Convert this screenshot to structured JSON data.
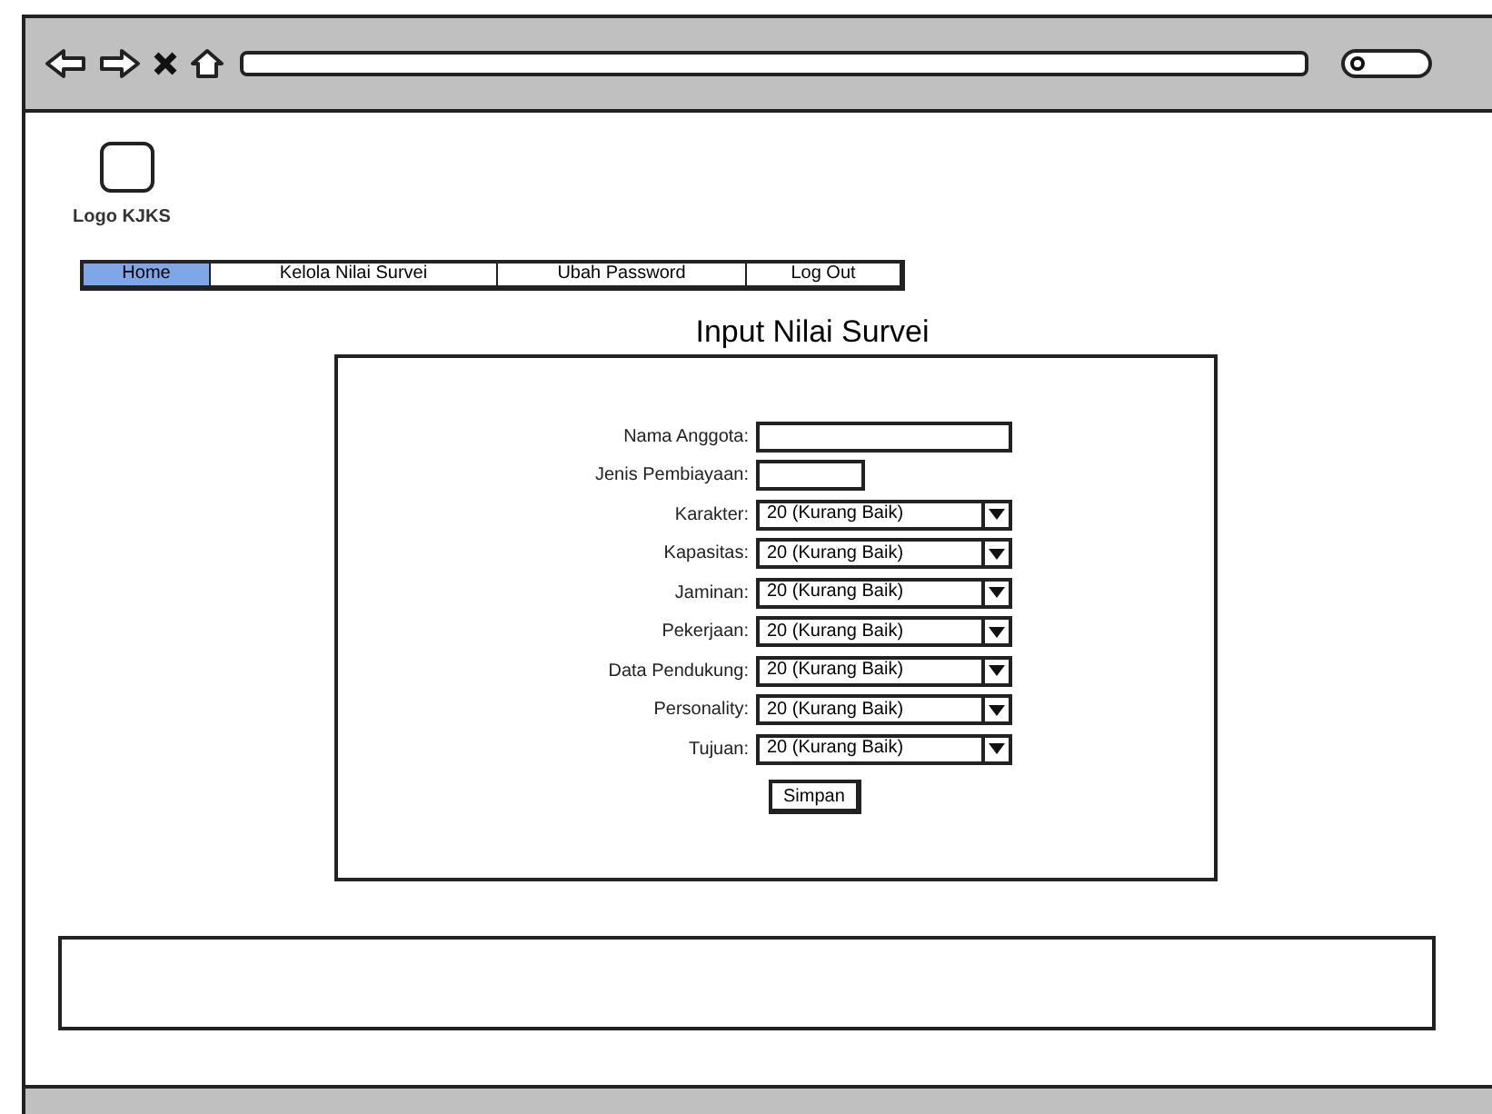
{
  "logo": {
    "label": "Logo KJKS"
  },
  "nav": [
    {
      "label": "Home",
      "selected": true
    },
    {
      "label": "Kelola Nilai Survei",
      "selected": false
    },
    {
      "label": "Ubah Password",
      "selected": false
    },
    {
      "label": "Log Out",
      "selected": false
    }
  ],
  "title": "Input Nilai Survei",
  "form": {
    "fields": [
      {
        "kind": "text",
        "label": "Nama Anggota:"
      },
      {
        "kind": "short",
        "label": "Jenis Pembiayaan:"
      },
      {
        "kind": "select",
        "label": "Karakter:",
        "value": "20 (Kurang Baik)"
      },
      {
        "kind": "select",
        "label": "Kapasitas:",
        "value": "20 (Kurang Baik)"
      },
      {
        "kind": "select",
        "label": "Jaminan:",
        "value": "20 (Kurang Baik)"
      },
      {
        "kind": "select",
        "label": "Pekerjaan:",
        "value": "20 (Kurang Baik)"
      },
      {
        "kind": "select",
        "label": "Data Pendukung:",
        "value": "20 (Kurang Baik)"
      },
      {
        "kind": "select",
        "label": "Personality:",
        "value": "20 (Kurang Baik)"
      },
      {
        "kind": "select",
        "label": "Tujuan:",
        "value": "20 (Kurang Baik)"
      }
    ],
    "submit": "Simpan"
  }
}
